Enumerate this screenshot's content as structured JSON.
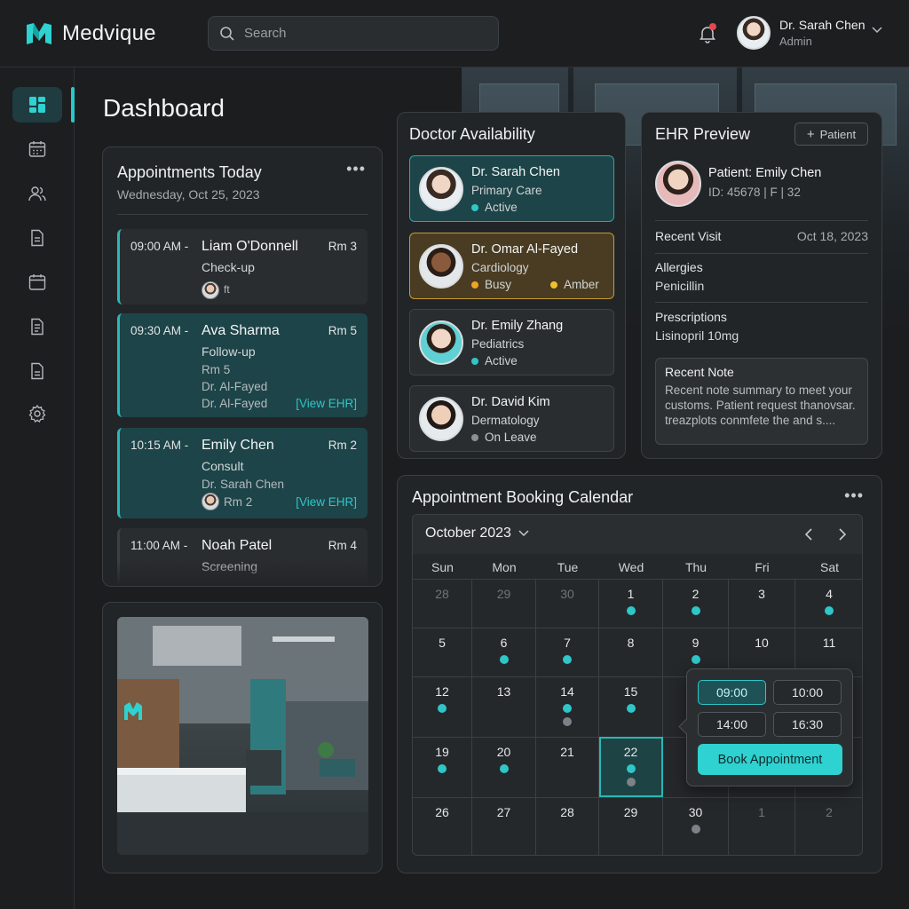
{
  "app": {
    "name": "Medvique"
  },
  "search": {
    "placeholder": "Search"
  },
  "user": {
    "name": "Dr. Sarah Chen",
    "role": "Admin"
  },
  "page": {
    "title": "Dashboard"
  },
  "appointments": {
    "title": "Appointments Today",
    "date": "Wednesday, Oct 25, 2023",
    "items": [
      {
        "time": "09:00 AM -",
        "patient": "Liam O'Donnell",
        "room": "Rm 3",
        "type": "Check-up",
        "extra": "ft"
      },
      {
        "time": "09:30 AM -",
        "patient": "Ava Sharma",
        "room": "Rm 5",
        "type": "Follow-up",
        "line1": "Rm 5",
        "line2": "Dr. Al-Fayed",
        "line3": "Dr. Al-Fayed",
        "link": "[View EHR]"
      },
      {
        "time": "10:15 AM -",
        "patient": "Emily Chen",
        "room": "Rm 2",
        "type": "Consult",
        "line1": "Dr. Sarah Chen",
        "line2": "Rm 2",
        "link": "[View EHR]"
      },
      {
        "time": "11:00 AM -",
        "patient": "Noah Patel",
        "room": "Rm 4",
        "type": "Screening"
      }
    ]
  },
  "doctors": {
    "title": "Doctor Availability",
    "items": [
      {
        "name": "Dr. Sarah Chen",
        "specialty": "Primary Care",
        "status": "Active",
        "status_color": "#2fc6c8"
      },
      {
        "name": "Dr. Omar Al-Fayed",
        "specialty": "Cardiology",
        "status": "Busy",
        "status_color": "#f0a423",
        "status2": "Amber",
        "status2_color": "#f2c12e"
      },
      {
        "name": "Dr. Emily Zhang",
        "specialty": "Pediatrics",
        "status": "Active",
        "status_color": "#2fc6c8"
      },
      {
        "name": "Dr. David Kim",
        "specialty": "Dermatology",
        "status": "On Leave",
        "status_color": "#8a9095"
      }
    ]
  },
  "ehr": {
    "title": "EHR Preview",
    "patient_button": "Patient",
    "patient_name": "Patient: Emily Chen",
    "patient_meta": "ID: 45678  |  F  |  32",
    "recent_visit_label": "Recent Visit",
    "recent_visit_date": "Oct 18, 2023",
    "allergies_label": "Allergies",
    "allergies_value": "Penicillin",
    "prescriptions_label": "Prescriptions",
    "prescriptions_value": "Lisinopril 10mg",
    "note_title": "Recent Note",
    "note_text": "Recent note summary to meet your customs. Patient request thanovsar. treazplots conmfete the and s...."
  },
  "calendar": {
    "title": "Appointment Booking Calendar",
    "month": "October 2023",
    "weekdays": [
      "Sun",
      "Mon",
      "Tue",
      "Wed",
      "Thu",
      "Fri",
      "Sat"
    ],
    "weeks": [
      [
        {
          "d": "28",
          "dim": true
        },
        {
          "d": "29",
          "dim": true
        },
        {
          "d": "30",
          "dim": true
        },
        {
          "d": "1",
          "dots": [
            "teal"
          ]
        },
        {
          "d": "2",
          "dots": [
            "teal"
          ]
        },
        {
          "d": "3"
        },
        {
          "d": "4",
          "dots": [
            "teal"
          ]
        }
      ],
      [
        {
          "d": "5"
        },
        {
          "d": "6",
          "dots": [
            "teal"
          ]
        },
        {
          "d": "7",
          "dots": [
            "teal"
          ]
        },
        {
          "d": "8"
        },
        {
          "d": "9",
          "dots": [
            "teal"
          ]
        },
        {
          "d": "10"
        },
        {
          "d": "11"
        }
      ],
      [
        {
          "d": "12",
          "dots": [
            "teal"
          ]
        },
        {
          "d": "13"
        },
        {
          "d": "14",
          "dots": [
            "teal",
            "gray"
          ]
        },
        {
          "d": "15",
          "dots": [
            "teal"
          ]
        },
        {
          "d": ""
        },
        {
          "d": ""
        },
        {
          "d": ""
        }
      ],
      [
        {
          "d": "19",
          "dots": [
            "teal"
          ]
        },
        {
          "d": "20",
          "dots": [
            "teal"
          ]
        },
        {
          "d": "21"
        },
        {
          "d": "22",
          "dots": [
            "teal",
            "gray"
          ],
          "today": true
        },
        {
          "d": ""
        },
        {
          "d": ""
        },
        {
          "d": ""
        }
      ],
      [
        {
          "d": "26"
        },
        {
          "d": "27"
        },
        {
          "d": "28"
        },
        {
          "d": "29"
        },
        {
          "d": "30",
          "dots": [
            "gray"
          ]
        },
        {
          "d": "1",
          "dim": true
        },
        {
          "d": "2",
          "dim": true
        }
      ]
    ],
    "slots": [
      "09:00",
      "10:00",
      "14:00",
      "16:30"
    ],
    "selected_slot": "09:00",
    "book_label": "Book Appointment"
  },
  "colors": {
    "accent": "#2ed2d0",
    "teal_dot": "#2fc6c8",
    "gray_dot": "#7c8287"
  }
}
